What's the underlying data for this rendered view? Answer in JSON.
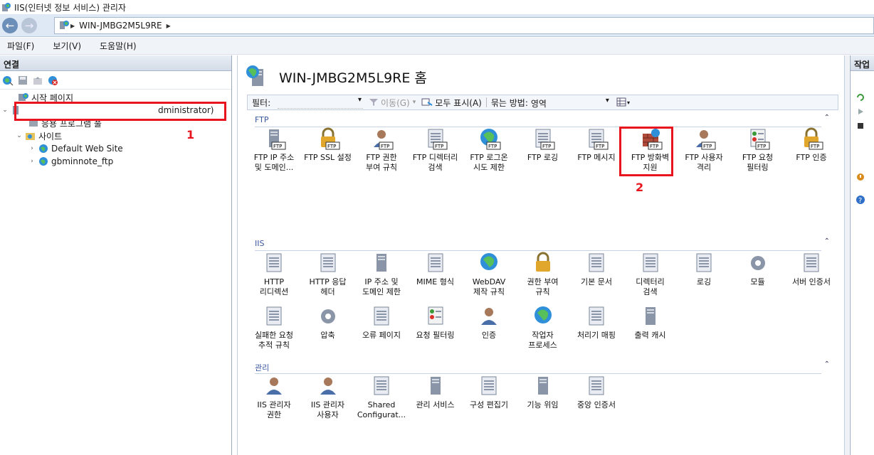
{
  "window": {
    "title": "IIS(인터넷 정보 서비스) 관리자"
  },
  "address": {
    "crumbs": [
      "WIN-JMBG2M5L9RE"
    ]
  },
  "menu": {
    "items": [
      "파일(F)",
      "보기(V)",
      "도움말(H)"
    ]
  },
  "connections": {
    "header": "연결",
    "tree": {
      "start_page": "시작 페이지",
      "server": "dministrator)",
      "app_pools": "응용 프로그램 풀",
      "sites": "사이트",
      "site1": "Default Web Site",
      "site2": "gbminnote_ftp"
    },
    "marker": "1"
  },
  "center": {
    "title": "WIN-JMBG2M5L9RE 홈",
    "filter": {
      "label": "필터:",
      "go": "이동(G)",
      "show_all": "모두 표시(A)",
      "group_by_label": "묶는 방법:",
      "group_by_value": "영역"
    },
    "sections": {
      "ftp": {
        "title": "FTP",
        "features": [
          "FTP IP 주소\n및 도메인...",
          "FTP SSL 설정",
          "FTP 권한\n부여 규칙",
          "FTP 디렉터리\n검색",
          "FTP 로그온\n시도 제한",
          "FTP 로깅",
          "FTP 메시지",
          "FTP 방화벽\n지원",
          "FTP 사용자\n격리",
          "FTP 요청\n필터링",
          "FTP 인증"
        ]
      },
      "iis": {
        "title": "IIS",
        "features": [
          "HTTP\n리디렉션",
          "HTTP 응답\n헤더",
          "IP 주소 및\n도메인 제한",
          "MIME 형식",
          "WebDAV\n제작 규칙",
          "권한 부여\n규칙",
          "기본 문서",
          "디렉터리\n검색",
          "로깅",
          "모듈",
          "서버 인증서",
          "실패한 요청\n추적 규칙",
          "압축",
          "오류 페이지",
          "요청 필터링",
          "인증",
          "작업자\n프로세스",
          "처리기 매핑",
          "출력 캐시"
        ]
      },
      "mgmt": {
        "title": "관리",
        "features": [
          "IIS 관리자\n권한",
          "IIS 관리자\n사용자",
          "Shared\nConfigurat...",
          "관리 서비스",
          "구성 편집기",
          "기능 위임",
          "중앙 인증서"
        ]
      }
    },
    "marker": "2"
  },
  "actions": {
    "header": "작업"
  },
  "colors": {
    "accent": "#3a57a0",
    "highlight": "#e8141e"
  }
}
